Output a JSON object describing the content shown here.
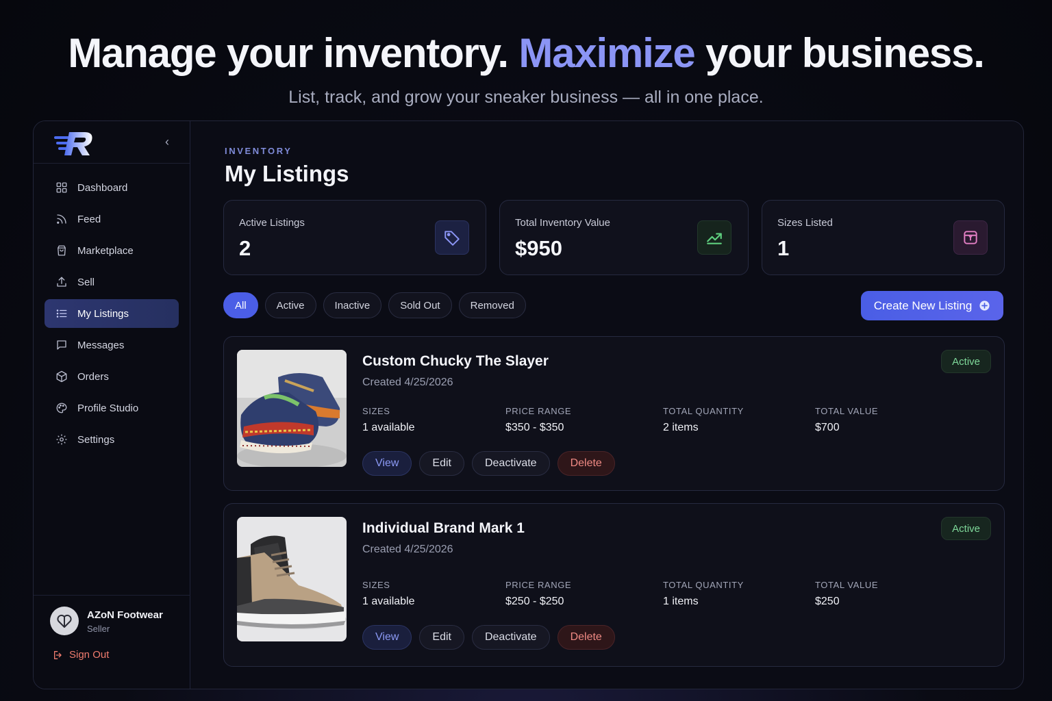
{
  "hero": {
    "title_part1": "Manage your inventory.",
    "title_accent": "Maximize",
    "title_part2": "your business.",
    "subtitle": "List, track, and grow your sneaker business — all in one place."
  },
  "sidebar": {
    "items": [
      {
        "label": "Dashboard",
        "icon": "grid-icon"
      },
      {
        "label": "Feed",
        "icon": "rss-icon"
      },
      {
        "label": "Marketplace",
        "icon": "bag-icon"
      },
      {
        "label": "Sell",
        "icon": "upload-icon"
      },
      {
        "label": "My Listings",
        "icon": "list-icon",
        "active": true
      },
      {
        "label": "Messages",
        "icon": "message-icon"
      },
      {
        "label": "Orders",
        "icon": "box-icon"
      },
      {
        "label": "Profile Studio",
        "icon": "palette-icon"
      },
      {
        "label": "Settings",
        "icon": "gear-icon"
      }
    ],
    "user": {
      "name": "AZoN Footwear",
      "role": "Seller"
    },
    "sign_out": "Sign Out"
  },
  "page": {
    "eyebrow": "INVENTORY",
    "title": "My Listings"
  },
  "stats": [
    {
      "label": "Active Listings",
      "value": "2",
      "icon": "tag-icon",
      "color": "#8b95f5"
    },
    {
      "label": "Total Inventory Value",
      "value": "$950",
      "icon": "trending-up-icon",
      "color": "#5fd07f"
    },
    {
      "label": "Sizes Listed",
      "value": "1",
      "icon": "package-icon",
      "color": "#e27fc4"
    }
  ],
  "filters": [
    "All",
    "Active",
    "Inactive",
    "Sold Out",
    "Removed"
  ],
  "active_filter": "All",
  "create_button": "Create New Listing",
  "metric_labels": {
    "sizes": "SIZES",
    "price": "PRICE RANGE",
    "qty": "TOTAL QUANTITY",
    "value": "TOTAL VALUE"
  },
  "action_labels": {
    "view": "View",
    "edit": "Edit",
    "deactivate": "Deactivate",
    "delete": "Delete"
  },
  "listings": [
    {
      "name": "Custom Chucky The Slayer",
      "created": "Created 4/25/2026",
      "status": "Active",
      "sizes": "1 available",
      "price_range": "$350 - $350",
      "total_quantity": "2 items",
      "total_value": "$700"
    },
    {
      "name": "Individual Brand Mark 1",
      "created": "Created 4/25/2026",
      "status": "Active",
      "sizes": "1 available",
      "price_range": "$250 - $250",
      "total_quantity": "1 items",
      "total_value": "$250"
    }
  ],
  "colors": {
    "accent": "#4b5ee6",
    "active_badge": "#7fd99a",
    "danger": "#f08a84"
  }
}
